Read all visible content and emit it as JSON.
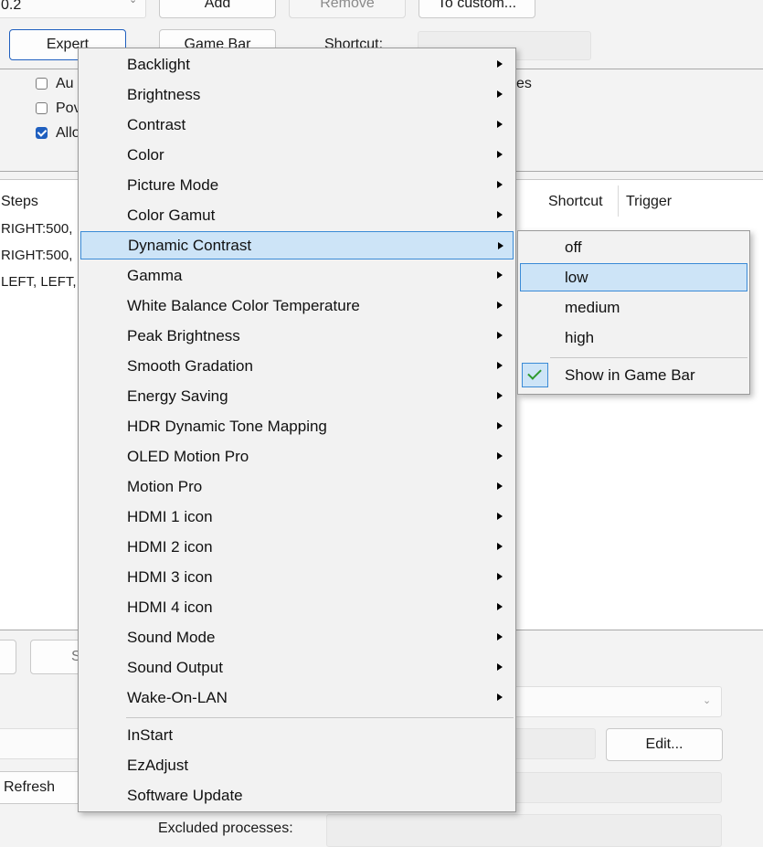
{
  "top_row": {
    "preset_value": "0.2",
    "add_label": "Add",
    "remove_label": "Remove",
    "to_custom_label": "To custom..."
  },
  "second_row": {
    "expert_label": "Expert",
    "gamebar_label": "Game Bar",
    "shortcut_label": "Shortcut:"
  },
  "options": [
    {
      "label": "Au",
      "checked": false
    },
    {
      "label": "Pov",
      "checked": false
    },
    {
      "label": "Allo",
      "checked": true
    }
  ],
  "options_right_fragment": "es",
  "table": {
    "columns": [
      "Steps",
      "Shortcut",
      "Trigger"
    ],
    "rows": [
      "RIGHT:500,",
      "RIGHT:500,",
      "LEFT, LEFT,"
    ]
  },
  "bottom": {
    "s_fragment": "S",
    "refresh_label": "Refresh",
    "edit_label": "Edit...",
    "excluded_label": "Excluded processes:"
  },
  "menu": {
    "items": [
      {
        "label": "Backlight",
        "submenu": true
      },
      {
        "label": "Brightness",
        "submenu": true
      },
      {
        "label": "Contrast",
        "submenu": true
      },
      {
        "label": "Color",
        "submenu": true
      },
      {
        "label": "Picture Mode",
        "submenu": true
      },
      {
        "label": "Color Gamut",
        "submenu": true
      },
      {
        "label": "Dynamic Contrast",
        "submenu": true,
        "highlighted": true
      },
      {
        "label": "Gamma",
        "submenu": true
      },
      {
        "label": "White Balance Color Temperature",
        "submenu": true
      },
      {
        "label": "Peak Brightness",
        "submenu": true
      },
      {
        "label": "Smooth Gradation",
        "submenu": true
      },
      {
        "label": "Energy Saving",
        "submenu": true
      },
      {
        "label": "HDR Dynamic Tone Mapping",
        "submenu": true
      },
      {
        "label": "OLED Motion Pro",
        "submenu": true
      },
      {
        "label": "Motion Pro",
        "submenu": true
      },
      {
        "label": "HDMI 1 icon",
        "submenu": true
      },
      {
        "label": "HDMI 2 icon",
        "submenu": true
      },
      {
        "label": "HDMI 3 icon",
        "submenu": true
      },
      {
        "label": "HDMI 4 icon",
        "submenu": true
      },
      {
        "label": "Sound Mode",
        "submenu": true
      },
      {
        "label": "Sound Output",
        "submenu": true
      },
      {
        "label": "Wake-On-LAN",
        "submenu": true
      }
    ],
    "extra_items": [
      {
        "label": "InStart"
      },
      {
        "label": "EzAdjust"
      },
      {
        "label": "Software Update"
      }
    ]
  },
  "submenu": {
    "items": [
      {
        "label": "off"
      },
      {
        "label": "low",
        "highlighted": true
      },
      {
        "label": "medium"
      },
      {
        "label": "high"
      }
    ],
    "show_in_gamebar_label": "Show in Game Bar",
    "show_in_gamebar_checked": true
  },
  "colors": {
    "accent": "#1f5fbf",
    "highlight_bg": "#cde4f7",
    "highlight_border": "#3a8ad6",
    "checkmark": "#2e9a2e"
  }
}
